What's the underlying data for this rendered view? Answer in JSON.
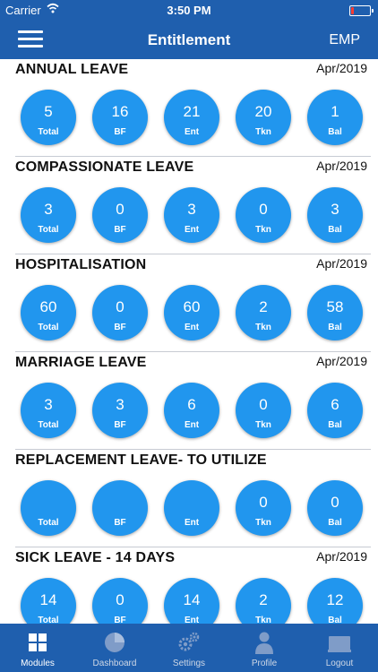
{
  "status_bar": {
    "carrier": "Carrier",
    "time": "3:50 PM"
  },
  "header": {
    "title": "Entitlement",
    "right_label": "EMP"
  },
  "colors": {
    "primary": "#1f5fae",
    "circle": "#2196ee",
    "battery_low": "#ff3b30"
  },
  "sections": [
    {
      "title": "ANNUAL LEAVE",
      "date": "Apr/2019",
      "stats": [
        {
          "value": "5",
          "label": "Total"
        },
        {
          "value": "16",
          "label": "BF"
        },
        {
          "value": "21",
          "label": "Ent"
        },
        {
          "value": "20",
          "label": "Tkn"
        },
        {
          "value": "1",
          "label": "Bal"
        }
      ]
    },
    {
      "title": "COMPASSIONATE LEAVE",
      "date": "Apr/2019",
      "stats": [
        {
          "value": "3",
          "label": "Total"
        },
        {
          "value": "0",
          "label": "BF"
        },
        {
          "value": "3",
          "label": "Ent"
        },
        {
          "value": "0",
          "label": "Tkn"
        },
        {
          "value": "3",
          "label": "Bal"
        }
      ]
    },
    {
      "title": "HOSPITALISATION",
      "date": "Apr/2019",
      "stats": [
        {
          "value": "60",
          "label": "Total"
        },
        {
          "value": "0",
          "label": "BF"
        },
        {
          "value": "60",
          "label": "Ent"
        },
        {
          "value": "2",
          "label": "Tkn"
        },
        {
          "value": "58",
          "label": "Bal"
        }
      ]
    },
    {
      "title": "MARRIAGE LEAVE",
      "date": "Apr/2019",
      "stats": [
        {
          "value": "3",
          "label": "Total"
        },
        {
          "value": "3",
          "label": "BF"
        },
        {
          "value": "6",
          "label": "Ent"
        },
        {
          "value": "0",
          "label": "Tkn"
        },
        {
          "value": "6",
          "label": "Bal"
        }
      ]
    },
    {
      "title": "REPLACEMENT LEAVE- TO UTILIZE",
      "date": "",
      "stats": [
        {
          "value": "",
          "label": "Total"
        },
        {
          "value": "",
          "label": "BF"
        },
        {
          "value": "",
          "label": "Ent"
        },
        {
          "value": "0",
          "label": "Tkn"
        },
        {
          "value": "0",
          "label": "Bal"
        }
      ]
    },
    {
      "title": "SICK LEAVE - 14 DAYS",
      "date": "Apr/2019",
      "stats": [
        {
          "value": "14",
          "label": "Total"
        },
        {
          "value": "0",
          "label": "BF"
        },
        {
          "value": "14",
          "label": "Ent"
        },
        {
          "value": "2",
          "label": "Tkn"
        },
        {
          "value": "12",
          "label": "Bal"
        }
      ]
    }
  ],
  "tabs": [
    {
      "label": "Modules",
      "icon": "grid-icon"
    },
    {
      "label": "Dashboard",
      "icon": "pie-chart-icon"
    },
    {
      "label": "Settings",
      "icon": "gears-icon"
    },
    {
      "label": "Profile",
      "icon": "person-icon"
    },
    {
      "label": "Logout",
      "icon": "laptop-icon"
    }
  ]
}
